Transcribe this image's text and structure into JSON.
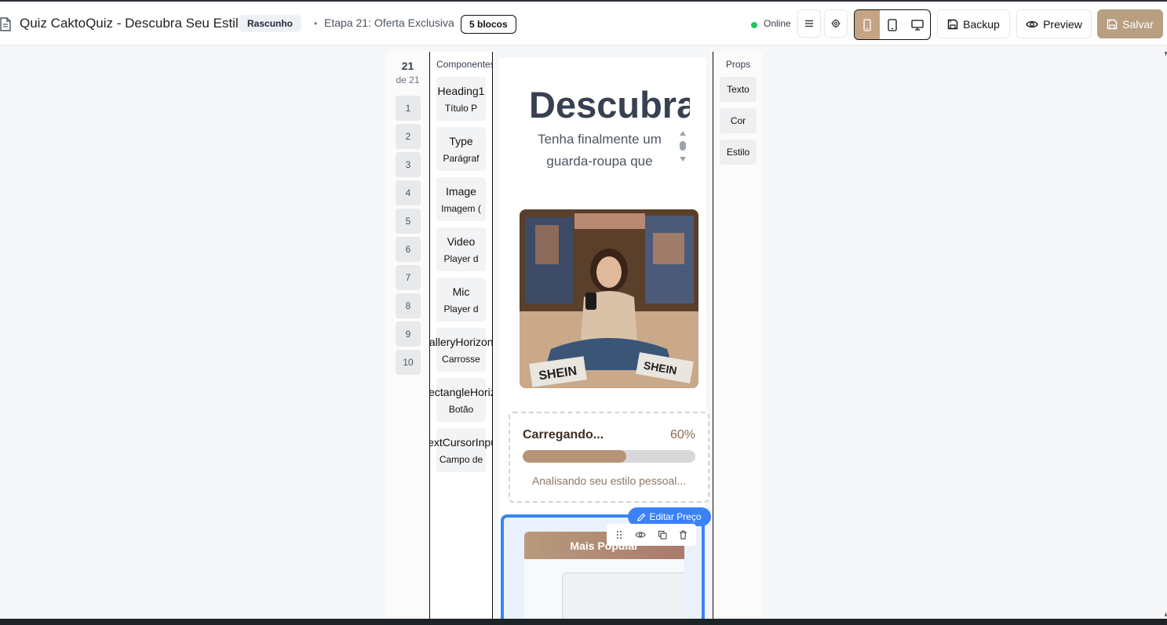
{
  "header": {
    "title": "Quiz CaktoQuiz - Descubra Seu Estilo",
    "draft_badge": "Rascunho",
    "step_bullet": "•",
    "step_label": "Etapa 21: Oferta Exclusiva",
    "blocks_badge": "5 blocos",
    "status": "Online",
    "backup_label": "Backup",
    "preview_label": "Preview",
    "save_label": "Salvar"
  },
  "steps": {
    "current": "21",
    "of_label": "de 21",
    "items": [
      "1",
      "2",
      "3",
      "4",
      "5",
      "6",
      "7",
      "8",
      "9",
      "10"
    ]
  },
  "components": {
    "title": "Componentes",
    "items": [
      {
        "name": "Heading1",
        "desc": "Título P"
      },
      {
        "name": "Type",
        "desc": "Parágraf"
      },
      {
        "name": "Image",
        "desc": "Imagem ("
      },
      {
        "name": "Video",
        "desc": "Player d"
      },
      {
        "name": "Mic",
        "desc": "Player d"
      },
      {
        "name": "GalleryHorizontal",
        "desc": "Carrosse"
      },
      {
        "name": "RectangleHorizontal",
        "desc": "Botão"
      },
      {
        "name": "TextCursorInput",
        "desc": "Campo de"
      }
    ]
  },
  "canvas": {
    "hero_title": "Descubra",
    "hero_subtitle": "Tenha finalmente um guarda-roupa que",
    "loader": {
      "title": "Carregando...",
      "percent_label": "60%",
      "progress": 0.6,
      "subtitle": "Analisando seu estilo pessoal..."
    },
    "price_card": {
      "header": "Mais Popular",
      "edit_button": "Editar Preço"
    }
  },
  "props": {
    "title": "Props",
    "items": [
      "Texto",
      "Cor",
      "Estilo"
    ]
  },
  "colors": {
    "accent": "#c4a484",
    "save": "#b89f82",
    "selection": "#3b82f6",
    "online": "#22c55e"
  }
}
